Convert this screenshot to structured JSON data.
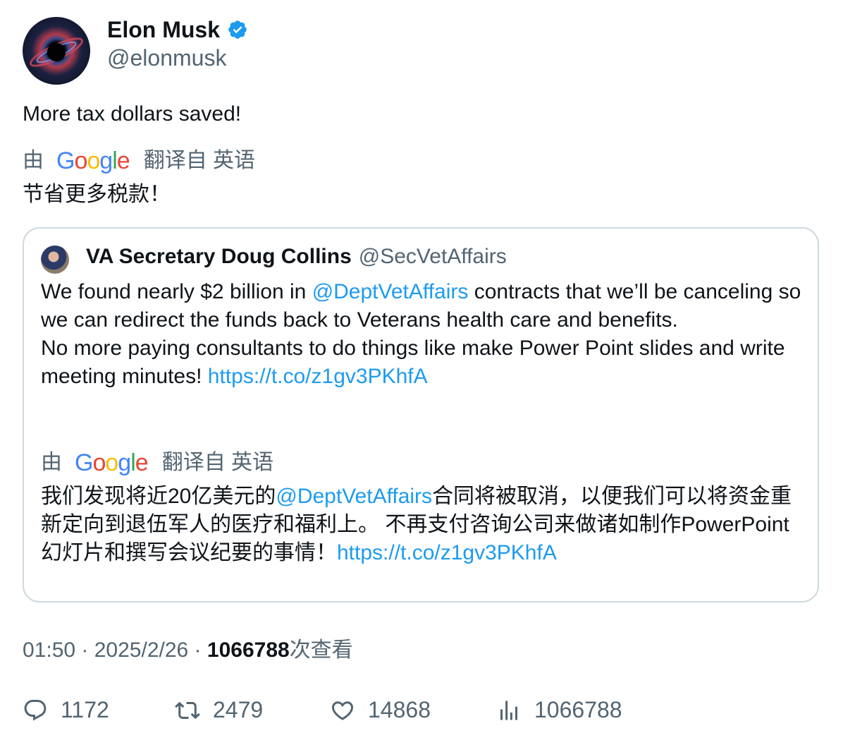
{
  "author": {
    "name": "Elon Musk",
    "handle": "@elonmusk",
    "verified_color": "#1d9bf0"
  },
  "tweet": {
    "text": "More tax dollars saved!",
    "translation": {
      "by": "由",
      "provider": "Google",
      "from_label": "翻译自 英语",
      "text": "节省更多税款！"
    }
  },
  "quote": {
    "name": "VA Secretary Doug Collins",
    "handle": "@SecVetAffairs",
    "body_part1": "We found nearly $2 billion in ",
    "body_mention": "@DeptVetAffairs",
    "body_part2": " contracts that we’ll be canceling so we can redirect the funds back to Veterans health care and benefits.",
    "body_line2": "No more paying consultants to do things like make Power Point slides and write meeting minutes! ",
    "body_link": "https://t.co/z1gv3PKhfA",
    "translation": {
      "by": "由",
      "provider": "Google",
      "from_label": "翻译自 英语",
      "part1": "我们发现将近20亿美元的",
      "mention": "@DeptVetAffairs",
      "part2": "合同将被取消，以便我们可以将资金重新定向到退伍军人的医疗和福利上。 不再支付咨询公司来做诸如制作PowerPoint幻灯片和撰写会议纪要的事情！",
      "link": "https://t.co/z1gv3PKhfA"
    }
  },
  "meta": {
    "time": "01:50",
    "sep1": " · ",
    "date": "2025/2/26",
    "sep2": " · ",
    "views": "1066788",
    "views_label": "次查看"
  },
  "actions": {
    "replies": "1172",
    "retweets": "2479",
    "likes": "14868",
    "views": "1066788"
  },
  "colors": {
    "text": "#0f1419",
    "secondary": "#536471",
    "link": "#1d9bf0",
    "border": "#cfd9de"
  }
}
